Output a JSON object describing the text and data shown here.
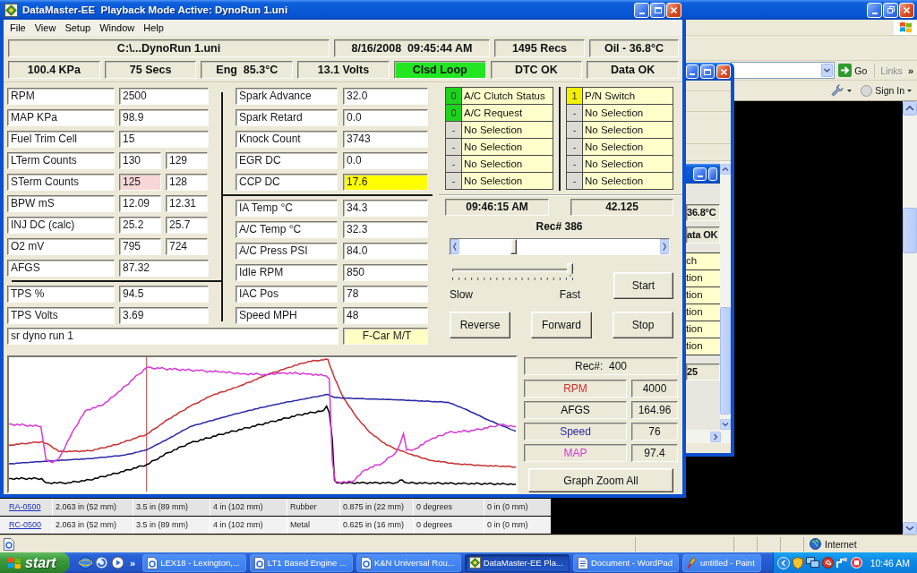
{
  "browser": {
    "go_button": "Go",
    "links_label": "Links",
    "links_more": "»",
    "sign_in": "Sign In",
    "table": {
      "rows": [
        {
          "part": "RA-0500",
          "cells": [
            "2.063 in (52 mm)",
            "3.5 in (89 mm)",
            "4 in (102 mm)",
            "Rubber",
            "0.875 in (22 mm)",
            "0 degrees",
            "0 in (0 mm)"
          ]
        },
        {
          "part": "RC-0500",
          "cells": [
            "2.063 in (52 mm)",
            "3.5 in (89 mm)",
            "4 in (102 mm)",
            "Metal",
            "0.625 in (16 mm)",
            "0 degrees",
            "0 in (0 mm)"
          ]
        }
      ]
    },
    "status_bar": {
      "zone": "Internet"
    }
  },
  "back_window": {
    "readings": [
      "36.8°C",
      "ata OK"
    ],
    "list": [
      "ch",
      "tion",
      "tion",
      "tion",
      "tion",
      "tion"
    ],
    "value": "25"
  },
  "main_window": {
    "title": "DataMaster-EE  Playback Mode Active: DynoRun 1.uni",
    "menu": [
      "File",
      "View",
      "Setup",
      "Window",
      "Help"
    ],
    "status_top": [
      {
        "text": "C:\\...DynoRun 1.uni"
      },
      {
        "text": "8/16/2008  09:45:44 AM"
      },
      {
        "text": "1495 Recs"
      },
      {
        "text": "Oil - 36.8°C"
      }
    ],
    "status_bottom": [
      {
        "text": "100.4 KPa"
      },
      {
        "text": "75 Secs"
      },
      {
        "text": "Eng  85.3°C"
      },
      {
        "text": "13.1 Volts"
      },
      {
        "text": "Clsd Loop",
        "color": "#22e622"
      },
      {
        "text": "DTC OK"
      },
      {
        "text": "Data OK"
      }
    ],
    "engine_params": {
      "upper": [
        {
          "label": "RPM",
          "values": [
            {
              "text": "2500"
            }
          ]
        },
        {
          "label": "MAP KPa",
          "values": [
            {
              "text": "98.9"
            }
          ]
        },
        {
          "label": "Fuel Trim Cell",
          "values": [
            {
              "text": "15"
            }
          ]
        },
        {
          "label": "LTerm Counts",
          "values": [
            {
              "text": "130"
            },
            {
              "text": "129"
            }
          ]
        },
        {
          "label": "STerm Counts",
          "values": [
            {
              "text": "125",
              "color": "#f6d6d6"
            },
            {
              "text": "128"
            }
          ]
        },
        {
          "label": "BPW  mS",
          "values": [
            {
              "text": "12.09"
            },
            {
              "text": "12.31"
            }
          ]
        },
        {
          "label": "INJ DC (calc)",
          "values": [
            {
              "text": "25.2"
            },
            {
              "text": "25.7"
            }
          ]
        },
        {
          "label": "O2 mV",
          "values": [
            {
              "text": "795"
            },
            {
              "text": "724"
            }
          ]
        },
        {
          "label": "AFGS",
          "values": [
            {
              "text": "87.32"
            }
          ]
        }
      ],
      "lower": [
        {
          "label": "TPS %",
          "values": [
            {
              "text": "94.5"
            }
          ]
        },
        {
          "label": "TPS Volts",
          "values": [
            {
              "text": "3.69"
            }
          ]
        }
      ]
    },
    "sensor_params": {
      "upper": [
        {
          "label": "Spark Advance",
          "values": [
            {
              "text": "32.0"
            }
          ]
        },
        {
          "label": "Spark Retard",
          "values": [
            {
              "text": "0.0"
            }
          ]
        },
        {
          "label": "Knock Count",
          "values": [
            {
              "text": "3743"
            }
          ]
        },
        {
          "label": "EGR DC",
          "values": [
            {
              "text": "0.0"
            }
          ]
        },
        {
          "label": "CCP DC",
          "values": [
            {
              "text": "17.6",
              "color": "#ffff00"
            }
          ]
        }
      ],
      "lower": [
        {
          "label": "IA Temp °C",
          "values": [
            {
              "text": "34.3"
            }
          ]
        },
        {
          "label": "A/C Temp °C",
          "values": [
            {
              "text": "32.3"
            }
          ]
        },
        {
          "label": "A/C Press PSI",
          "values": [
            {
              "text": "84.0"
            }
          ]
        },
        {
          "label": "Idle RPM",
          "values": [
            {
              "text": "850"
            }
          ]
        },
        {
          "label": "IAC Pos",
          "values": [
            {
              "text": "78"
            }
          ]
        },
        {
          "label": "Speed MPH",
          "values": [
            {
              "text": "48"
            }
          ]
        }
      ]
    },
    "notes": "sr dyno run 1",
    "vehicle": "F-Car M/T",
    "switch_rows": [
      {
        "cells": [
          {
            "value": "0",
            "label": "A/C Clutch Status",
            "color": "#1ed21e"
          },
          {
            "value": "1",
            "label": "P/N Switch",
            "color": "#f2f000"
          }
        ]
      },
      {
        "cells": [
          {
            "value": "0",
            "label": "A/C Request",
            "color": "#1ed21e"
          },
          {
            "value": "-",
            "label": "No Selection",
            "color": "#dcdad3"
          }
        ]
      },
      {
        "cells": [
          {
            "value": "-",
            "label": "No Selection",
            "color": "#dcdad3"
          },
          {
            "value": "-",
            "label": "No Selection",
            "color": "#dcdad3"
          }
        ]
      },
      {
        "cells": [
          {
            "value": "-",
            "label": "No Selection",
            "color": "#dcdad3"
          },
          {
            "value": "-",
            "label": "No Selection",
            "color": "#dcdad3"
          }
        ]
      },
      {
        "cells": [
          {
            "value": "-",
            "label": "No Selection",
            "color": "#dcdad3"
          },
          {
            "value": "-",
            "label": "No Selection",
            "color": "#dcdad3"
          }
        ]
      },
      {
        "cells": [
          {
            "value": "-",
            "label": "No Selection",
            "color": "#dcdad3"
          },
          {
            "value": "-",
            "label": "No Selection",
            "color": "#dcdad3"
          }
        ]
      }
    ],
    "clock": "09:46:15 AM",
    "elapsed": "42.125",
    "record": "Rec# 386",
    "position_slider": {
      "level": 0.27
    },
    "speed_slider": {
      "level": 0.98,
      "min_label": "Slow",
      "max_label": "Fast"
    },
    "start_button": "Start",
    "transport_buttons": [
      "Reverse",
      "Forward",
      "Stop"
    ],
    "graph": {
      "record": "Rec#:  400",
      "channels": [
        {
          "name": "RPM",
          "value": "4000",
          "color": "#c83030"
        },
        {
          "name": "AFGS",
          "value": "164.96",
          "color": "#000000"
        },
        {
          "name": "Speed",
          "value": "76",
          "color": "#2a2aa8"
        },
        {
          "name": "MAP",
          "value": "97.4",
          "color": "#d838d8"
        }
      ],
      "zoom_button": "Graph Zoom All"
    }
  },
  "taskbar": {
    "start": "start",
    "quick_launch_more": "»",
    "tasks": [
      {
        "label": "LEX18 - Lexington,...",
        "kind": "web",
        "selected": false
      },
      {
        "label": "LT1 Based Engine ...",
        "kind": "web",
        "selected": false
      },
      {
        "label": "K&N Universal Rou...",
        "kind": "web",
        "selected": false
      },
      {
        "label": "DataMaster-EE Pla...",
        "kind": "app",
        "selected": true
      },
      {
        "label": "Document - WordPad",
        "kind": "document",
        "selected": false
      },
      {
        "label": "untitled - Paint",
        "kind": "paint",
        "selected": false
      }
    ],
    "clock": "10:46 AM"
  }
}
